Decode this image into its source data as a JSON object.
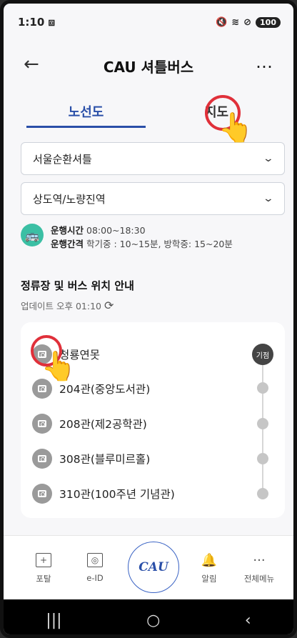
{
  "status_bar": {
    "time": "1:10",
    "left_icon": "screenshot-icon",
    "battery": "100"
  },
  "header": {
    "title": "CAU 셔틀버스",
    "back_icon": "←",
    "more_icon": "…"
  },
  "tabs": [
    {
      "label": "노선도",
      "active": true
    },
    {
      "label": "지도",
      "active": false
    }
  ],
  "selects": {
    "route": "서울순환셔틀",
    "direction": "상도역/노량진역"
  },
  "info": {
    "hours_label": "운행시간",
    "hours_value": "08:00~18:30",
    "interval_label": "운행간격",
    "interval_value": "학기중 : 10~15분, 방학중: 15~20분"
  },
  "section": {
    "title": "정류장 및 버스 위치 안내",
    "update": "업데이트 오후 01:10"
  },
  "stops": [
    {
      "name": "청룡연못",
      "badge": "기점"
    },
    {
      "name": "204관(중앙도서관)"
    },
    {
      "name": "208관(제2공학관)"
    },
    {
      "name": "308관(블루미르홀)"
    },
    {
      "name": "310관(100주년 기념관)"
    }
  ],
  "bottom_nav": {
    "portal": "포탈",
    "eid": "e-ID",
    "center": "CAU",
    "alarm": "알림",
    "menu": "전체메뉴"
  },
  "colors": {
    "accent": "#2a4fa8",
    "bus": "#3bbfa4",
    "highlight": "#e0303a"
  }
}
